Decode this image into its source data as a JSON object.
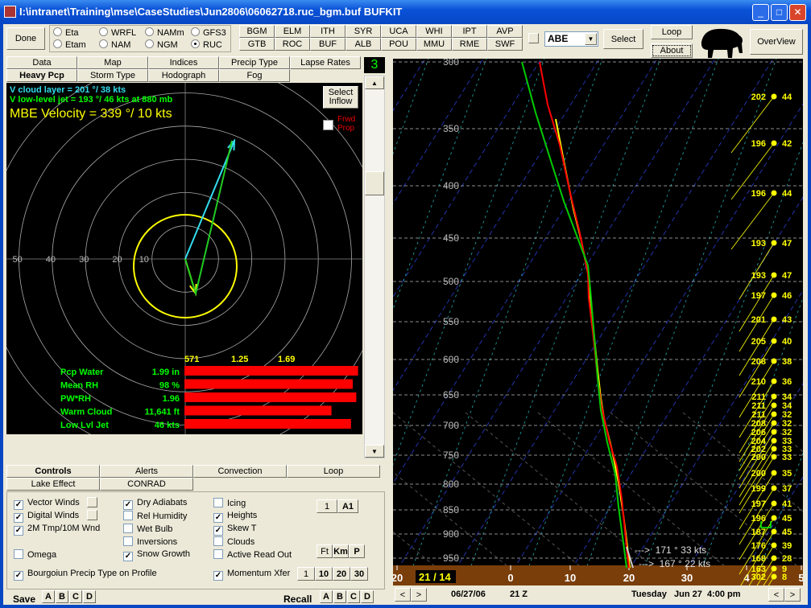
{
  "window": {
    "title": "I:\\intranet\\Training\\mse\\CaseStudies\\Jun2806\\06062718.ruc_bgm.buf BUFKIT",
    "minimize": "_",
    "maximize": "□",
    "close": "✕"
  },
  "toolbar": {
    "done": "Done",
    "models": [
      {
        "label": "Eta",
        "on": false
      },
      {
        "label": "WRFL",
        "on": false
      },
      {
        "label": "NAMm",
        "on": false
      },
      {
        "label": "GFS3",
        "on": false
      },
      {
        "label": "Etam",
        "on": false
      },
      {
        "label": "NAM",
        "on": false
      },
      {
        "label": "NGM",
        "on": false
      },
      {
        "label": "RUC",
        "on": true
      }
    ],
    "stations": [
      "BGM",
      "ELM",
      "ITH",
      "SYR",
      "UCA",
      "WHI",
      "IPT",
      "AVP",
      "GTB",
      "ROC",
      "BUF",
      "ALB",
      "POU",
      "MMU",
      "RME",
      "SWF"
    ],
    "station_select": "ABE",
    "select": "Select",
    "loop": "Loop",
    "about": "About",
    "overview": "OverView"
  },
  "top_tabs": {
    "row1": [
      "Data",
      "Map",
      "Indices",
      "Precip Type",
      "Lapse Rates"
    ],
    "row2": [
      "Heavy Pcp",
      "Storm Type",
      "Hodograph",
      "Fog"
    ],
    "selected": "Heavy Pcp",
    "counter": "3"
  },
  "hodo": {
    "cloud_layer": "V cloud layer   =  201 °/ 38 kts",
    "llj": "V low-level jet =  193 °/ 46 kts at  880 mb",
    "mbe": "MBE Velocity  =  339 °/ 10 kts",
    "select_inflow_1": "Select",
    "select_inflow_2": "Inflow",
    "frwd_1": "Frwd",
    "frwd_2": "Prop",
    "ring_labels": [
      "50",
      "40",
      "30",
      "20",
      "10"
    ],
    "scale_labels": [
      "571",
      "1.25",
      "1.69"
    ],
    "params": [
      {
        "label": "Pcp Water",
        "value": "1.99 in",
        "fill": 0.98
      },
      {
        "label": "Mean RH",
        "value": "98 %",
        "fill": 0.95
      },
      {
        "label": "PW*RH",
        "value": "1.96",
        "fill": 0.97
      },
      {
        "label": "Warm Cloud",
        "value": "11,641 ft",
        "fill": 0.83
      },
      {
        "label": "Low Lvl Jet",
        "value": "46 kts",
        "fill": 0.94
      }
    ]
  },
  "bottom_tabs": {
    "row1": [
      "Controls",
      "Alerts",
      "Convection",
      "Loop"
    ],
    "row2": [
      "Lake Effect",
      "CONRAD"
    ],
    "selected": "Controls"
  },
  "controls": {
    "col1": [
      {
        "label": "Vector Winds",
        "checked": true
      },
      {
        "label": "Digital Winds",
        "checked": true
      },
      {
        "label": "2M Tmp/10M Wnd",
        "checked": true
      },
      {
        "label": "Omega",
        "checked": false
      },
      {
        "label": "Bourgoiun  Precip Type on Profile",
        "checked": true
      }
    ],
    "col2": [
      {
        "label": "Dry Adiabats",
        "checked": true
      },
      {
        "label": "Rel Humidity",
        "checked": false
      },
      {
        "label": "Wet Bulb",
        "checked": false
      },
      {
        "label": "Inversions",
        "checked": false
      },
      {
        "label": "Snow Growth",
        "checked": true
      }
    ],
    "col3": [
      {
        "label": "Icing",
        "checked": false
      },
      {
        "label": "Heights",
        "checked": true
      },
      {
        "label": "Skew T",
        "checked": true
      },
      {
        "label": "Clouds",
        "checked": false
      },
      {
        "label": "Active Read Out",
        "checked": false
      },
      {
        "label": "Momentum Xfer",
        "checked": true
      }
    ],
    "btn_a": [
      "1",
      "A1"
    ],
    "btn_units": [
      "Ft",
      "Km",
      "P"
    ],
    "btn_mom": [
      "1",
      "10",
      "20",
      "30"
    ],
    "save": "Save",
    "recall": "Recall",
    "slots": [
      "A",
      "B",
      "C",
      "D"
    ]
  },
  "skewt": {
    "pressures": [
      "300",
      "350",
      "400",
      "450",
      "500",
      "550",
      "600",
      "650",
      "700",
      "750",
      "800",
      "850",
      "900",
      "950"
    ],
    "temps": [
      "20",
      "0",
      "10",
      "20",
      "30",
      "4",
      "5"
    ],
    "readout": "21 / 14",
    "winds": [
      [
        "202",
        "44"
      ],
      [
        "196",
        "42"
      ],
      [
        "196",
        "44"
      ],
      [
        "193",
        "47"
      ],
      [
        "193",
        "47"
      ],
      [
        "197",
        "46"
      ],
      [
        "201",
        "43"
      ],
      [
        "205",
        "40"
      ],
      [
        "208",
        "38"
      ],
      [
        "210",
        "36"
      ],
      [
        "211",
        "34"
      ],
      [
        "211",
        "34"
      ],
      [
        "211",
        "32"
      ],
      [
        "208",
        "32"
      ],
      [
        "206",
        "32"
      ],
      [
        "204",
        "33"
      ],
      [
        "202",
        "33"
      ],
      [
        "200",
        "33"
      ],
      [
        "200",
        "35"
      ],
      [
        "199",
        "37"
      ],
      [
        "197",
        "41"
      ],
      [
        "196",
        "45"
      ],
      [
        "187",
        "45"
      ],
      [
        "176",
        "39"
      ],
      [
        "168",
        "28"
      ],
      [
        "163",
        "9"
      ],
      [
        "302",
        "8"
      ]
    ],
    "sfc_wind_1": "--->  171 ° 33 kts",
    "sfc_wind_2": "--->  167 ° 22 kts",
    "date": "06/27/06",
    "hour": "21 Z",
    "local": "Tuesday   Jun 27  4:00 pm",
    "prev": "<",
    "next": ">"
  },
  "colors": {
    "temp": "#ff0000",
    "dew": "#00cc00",
    "wetbulb": "#ffff00",
    "ground": "#7a3e0a"
  }
}
